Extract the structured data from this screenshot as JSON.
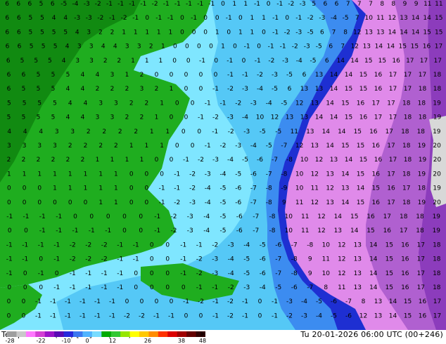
{
  "title": "Temperature (2m) [°C] EC (AIFS)",
  "valid_time": "Tu 20-01-2026 06:00 UTC (00+246)",
  "legend": {
    "ticks": [
      "-28",
      "-22",
      "-10",
      "0",
      "12",
      "26",
      "38",
      "48"
    ],
    "colors": [
      "#9e9e9e",
      "#c8c8c8",
      "#ff78ff",
      "#d440d4",
      "#9b14c8",
      "#5a0ab4",
      "#2828dc",
      "#3c78f0",
      "#50b4ff",
      "#78dcff",
      "#00aa00",
      "#32c832",
      "#96e600",
      "#ffff00",
      "#ffc800",
      "#ff8c00",
      "#ff3200",
      "#dc0000",
      "#a00000",
      "#640000",
      "#320000"
    ]
  },
  "map": {
    "colors": {
      "dark_green": "#118a11",
      "green": "#1fad1f",
      "light_cyan": "#7fe6ff",
      "cyan": "#55c8f6",
      "mid_blue": "#3c8cf0",
      "deep_blue": "#1e2fd2",
      "magenta": "#e08aea",
      "pink": "#f5a8f5",
      "purple": "#b060d0",
      "deep_purple": "#8c3cbc",
      "land_gray": "#d8d8d8"
    },
    "value_rows": [
      "6 6 6 5 6 -5 -4 -3 -2 -1 -1 -1 -1 -2 -1 -1 -1 -1 -1 0 1 1 -1 0 -1 -2 -3 5 6 6 7 7 7 8 8 9 9 11 11",
      "6 6 5 5 4 4 -3 -3 -2 -1 -2 -1 0 -1 -1 0 -1 0 0 -1 0 1 1 -1 0 -1 -2 -3 -4 -5 7 10 11 12 13 14 14 15",
      "6 6 5 5 5 5 4 3 2 2 1 1 1 1 1 0 0 0 1 0 1 1 0 -1 -2 -3 -5 6 7 8 12 13 13 14 14 14 15 15",
      "6 6 5 5 5 4 3 3 4 4 3 3 2 1 0 0 0 0 1 0 -1 0 -1 -1 -2 -3 -5 6 7 12 13 14 14 15 15 16 17",
      "6 5 5 5 4 3 3 2 2 1 1 1 0 0 -1 0 -1 0 -1 -2 -3 -4 -5 6 14 14 15 15 16 17 17 17",
      "6 6 5 5 5 4 4 3 1 2 0 0 0 0 0 -1 -1 -2 -3 -5 6 13 14 14 15 16 17 17 17 18",
      "6 5 5 5 4 4 2 2 2 3 2 1 0 0 -1 -2 -3 -4 -5 6 13 13 14 15 15 16 17 17 18 18",
      "5 5 5 5 4 4 3 3 2 2 1 0 0 -1 -1 -2 -3 -4 -5 12 13 14 15 16 17 17 18 18 19",
      "5 5 5 5 4 4 3 3 2 2 1 0 0 -1 -2 -3 -4 10 12 13 13 14 14 15 16 17 17 18 18 19",
      "4 4 4 3 3 2 2 2 2 1 1 0 0 -1 -2 -3 -5 -5 11 13 14 14 15 16 17 18 18 19",
      "3 3 3 3 2 2 2 2 1 1 1 0 0 -1 -2 -3 -4 -5 -7 12 13 14 15 15 16 17 18 19 20",
      "2 2 2 2 2 2 1 1 1 1 0 0 -1 -2 -3 -4 -5 -6 -7 -8 10 12 13 14 15 16 17 18 19 20",
      "1 1 1 1 1 1 1 1 0 0 0 -1 -2 -3 -4 -5 -6 -7 -8 10 12 13 14 15 16 17 18 19 20",
      "0 0 0 1 1 1 1 1 0 0 -1 -1 -2 -4 -5 -6 -7 -8 -9 10 11 12 13 14 15 16 17 18 19",
      "0 0 0 0 0 0 1 1 0 0 -1 -2 -3 -4 -5 -6 -7 -8 9 11 12 13 14 15 16 17 18 19 20",
      "-1 -1 -1 -1 0 0 0 0 0 -1 -2 -3 -4 -5 -6 -7 -8 10 11 12 14 15 16 17 18 18 19",
      "0 0 -1 -1 -1 -1 -1 0 0 -1 -2 -3 -4 -5 -6 -7 -8 10 11 12 13 14 15 16 17 18 19",
      "-1 -1 -1 -1 -2 -2 -2 -1 -1 0 0 -1 -1 -2 -3 -4 -5 -6 -7 -8 10 12 13 14 15 16 17 18",
      "-1 -1 0 -1 -2 -2 -2 -1 -1 0 0 -1 -2 -3 -4 -5 -6 -7 -8 9 11 12 13 14 15 16 17 18",
      "-1 0 -1 0 -1 -1 -1 -1 0 0 0 -1 -2 -3 -4 -5 -6 -7 -8 9 10 12 13 14 15 16 17 18",
      "0 0 0 -1 -1 -1 -1 -1 0 0 0 0 -1 -1 -2 -3 -4 -5 -6 -7 8 11 13 14 15 16 17 18",
      "0 0 -1 -1 -1 -1 -1 -1 0 0 0 0 -1 -2 -1 -2 -1 0 -1 -3 -4 -5 -6 -7 8 13 14 15 16 17",
      "0 0 -1 -1 -1 -1 -1 -1 -2 -2 -1 -1 0 0 -1 -2 -1 0 -1 -2 -3 -4 -5 -6 12 13 14 15 16 17"
    ]
  }
}
